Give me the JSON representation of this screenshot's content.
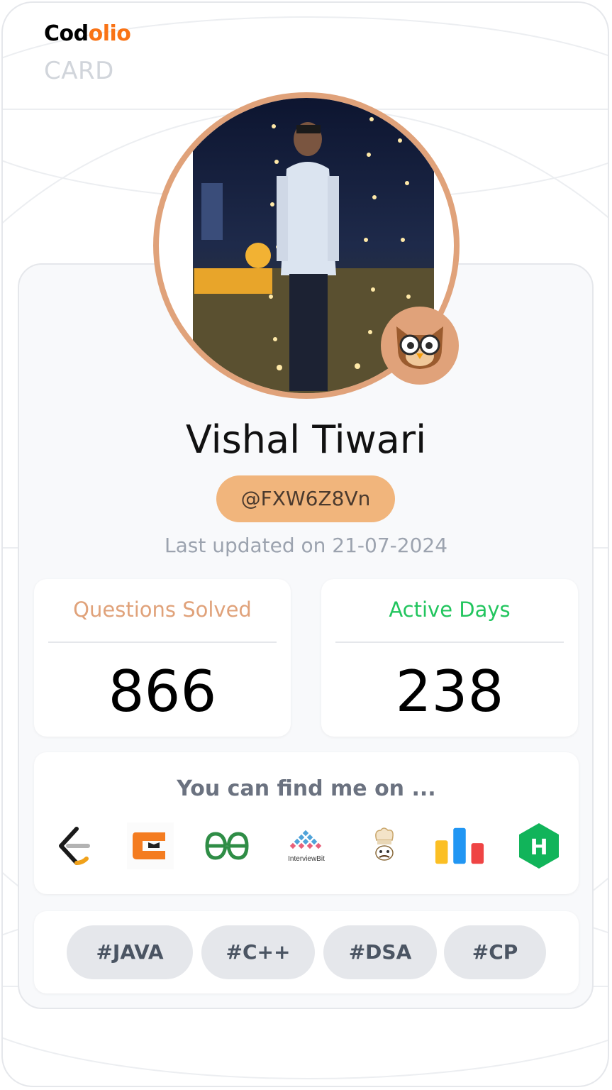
{
  "brand": {
    "part1": "Cod",
    "part2": "olio",
    "subtitle": "CARD"
  },
  "profile": {
    "name": "Vishal Tiwari",
    "handle": "@FXW6Z8Vn",
    "last_updated": "Last updated on 21-07-2024",
    "avatar": "profile-photo",
    "badge_icon": "owl-icon"
  },
  "stats": [
    {
      "label": "Questions Solved",
      "value": "866",
      "color": "#e0a27a"
    },
    {
      "label": "Active Days",
      "value": "238",
      "color": "#22c55e"
    }
  ],
  "find": {
    "title": "You can find me on ...",
    "platforms": [
      {
        "name": "leetcode-icon"
      },
      {
        "name": "codingninjas-icon"
      },
      {
        "name": "geeksforgeeks-icon"
      },
      {
        "name": "interviewbit-icon",
        "label": "InterviewBit"
      },
      {
        "name": "codechef-icon"
      },
      {
        "name": "codestudio-bars-icon"
      },
      {
        "name": "hackerrank-icon",
        "label": "H"
      }
    ]
  },
  "tags": [
    "#JAVA",
    "#C++",
    "#DSA",
    "#CP"
  ],
  "colors": {
    "accent": "#f97316",
    "ring": "#e0a27a",
    "handle_bg": "#f1b57c",
    "active": "#22c55e"
  }
}
